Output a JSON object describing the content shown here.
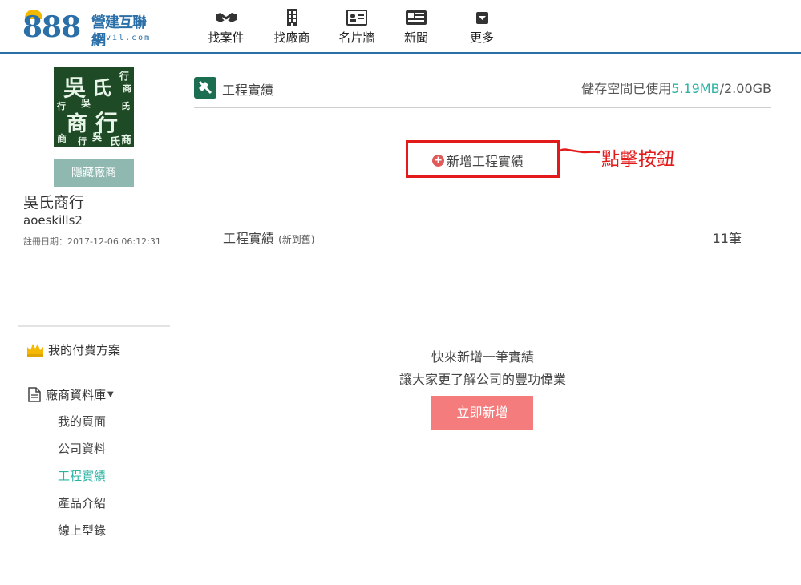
{
  "logo": {
    "number": "888",
    "name": "營建互聯網",
    "url": "civil.com"
  },
  "nav": [
    {
      "label": "找案件",
      "icon": "handshake-icon"
    },
    {
      "label": "找廠商",
      "icon": "building-icon"
    },
    {
      "label": "名片牆",
      "icon": "id-card-icon"
    },
    {
      "label": "新聞",
      "icon": "newspaper-icon"
    },
    {
      "label": "更多",
      "icon": "dropdown-icon"
    }
  ],
  "profile": {
    "avatar_text": [
      "吳",
      "氏",
      "商",
      "行",
      "行",
      "吳",
      "氏",
      "商",
      "行",
      "吳",
      "氏",
      "商",
      "行",
      "吳",
      "氏",
      "商"
    ],
    "hide_button": "隱藏廠商",
    "company_name": "吳氏商行",
    "account": "aoeskills2",
    "register_date": "註冊日期：2017-12-06 06:12:31"
  },
  "sidebar": {
    "plan_label": "我的付費方案",
    "db_label": "廠商資料庫",
    "sub_items": [
      {
        "label": "我的頁面",
        "active": false
      },
      {
        "label": "公司資料",
        "active": false
      },
      {
        "label": "工程實績",
        "active": true
      },
      {
        "label": "產品介紹",
        "active": false
      },
      {
        "label": "線上型錄",
        "active": false
      }
    ]
  },
  "main": {
    "title": "工程實績",
    "storage_prefix": "儲存空間已使用",
    "storage_used": "5.19MB",
    "storage_total": "/2.00GB",
    "add_label": "新增工程實績",
    "annotation": "點擊按鈕",
    "section_label": "工程實績",
    "section_sort": "(新到舊)",
    "section_count": "11筆",
    "empty_line1": "快來新增一筆實績",
    "empty_line2": "讓大家更了解公司的豐功偉業",
    "add_now": "立即新增"
  },
  "colors": {
    "brand_blue": "#2a6fa8",
    "teal": "#2bb3a2",
    "red": "#e31a1a",
    "pink": "#f47c7c"
  }
}
